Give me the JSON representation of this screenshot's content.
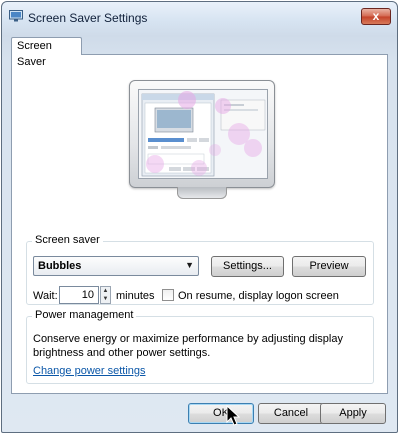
{
  "window": {
    "title": "Screen Saver Settings",
    "close_label": "x"
  },
  "tabs": [
    {
      "label": "Screen Saver",
      "selected": true
    }
  ],
  "screen_saver": {
    "group_label": "Screen saver",
    "selected": "Bubbles",
    "settings_label": "Settings...",
    "preview_label": "Preview",
    "wait_label": "Wait:",
    "wait_value": "10",
    "minutes_label": "minutes",
    "resume_label": "On resume, display logon screen",
    "resume_checked": false
  },
  "power_management": {
    "group_label": "Power management",
    "description": "Conserve energy or maximize performance by adjusting display brightness and other power settings.",
    "link_label": "Change power settings"
  },
  "buttons": {
    "ok_label": "OK",
    "cancel_label": "Cancel",
    "apply_label": "Apply"
  },
  "colors": {
    "link": "#0b57a8",
    "close_button": "#c4432a",
    "bubble": "#e6a8e6"
  }
}
